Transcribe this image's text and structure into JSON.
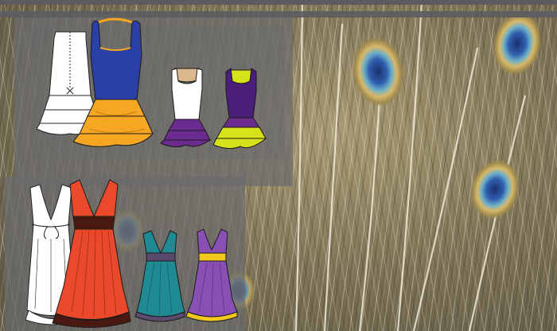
{
  "scene": {
    "background": "peacock-feathers",
    "panels": [
      {
        "name": "top-panel",
        "garments": [
          {
            "name": "white-tiered-dress-back-sketch",
            "colors": [
              "#ffffff"
            ]
          },
          {
            "name": "blue-orange-ruffle-dress",
            "colors": [
              "#2b3fa8",
              "#f5a623"
            ]
          },
          {
            "name": "white-purple-ruffle-dress",
            "colors": [
              "#ffffff",
              "#6a2c8f"
            ]
          },
          {
            "name": "purple-yellow-ruffle-dress",
            "colors": [
              "#4a1f7a",
              "#d8e21a"
            ]
          }
        ]
      },
      {
        "name": "bottom-panel",
        "garments": [
          {
            "name": "white-vneck-dress-sketch",
            "colors": [
              "#ffffff"
            ]
          },
          {
            "name": "red-vneck-pleated-dress",
            "colors": [
              "#ea4a2b",
              "#4a1a12"
            ]
          },
          {
            "name": "teal-vneck-dress",
            "colors": [
              "#1f8a92",
              "#5a4a6e"
            ]
          },
          {
            "name": "violet-vneck-dress",
            "colors": [
              "#8a4fb5",
              "#f2c81e"
            ]
          }
        ]
      }
    ]
  },
  "colors": {
    "frame": "#5c5c60",
    "panel": "#6e6e70",
    "feather_eye_blue": "#2f5fae",
    "feather_eye_gold": "#c8b46a"
  }
}
